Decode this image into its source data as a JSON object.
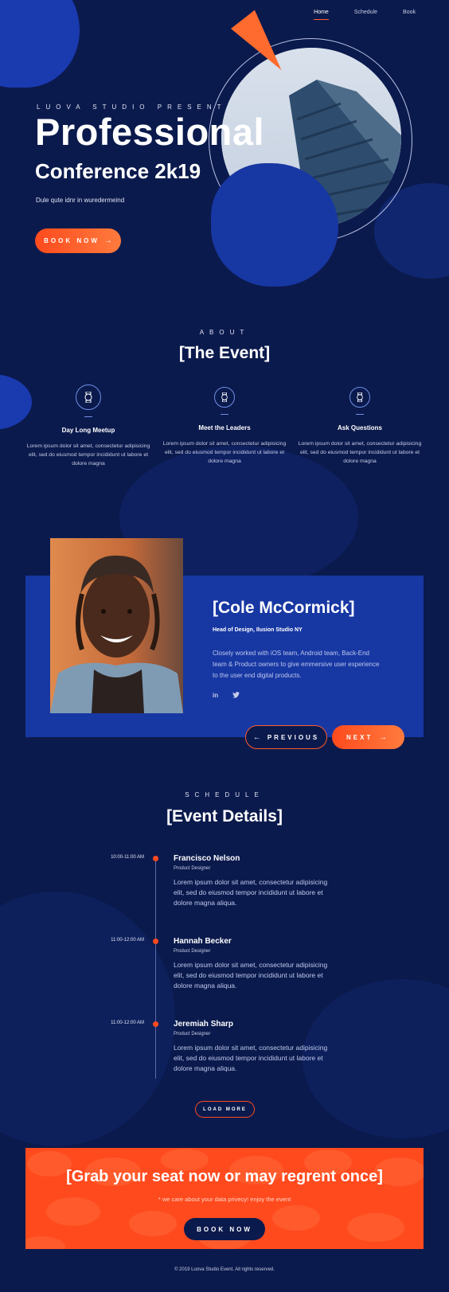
{
  "nav": {
    "items": [
      {
        "label": "Home",
        "active": true
      },
      {
        "label": "Schedule"
      },
      {
        "label": "Book"
      }
    ]
  },
  "hero": {
    "kicker": "LUOVA STUDIO PRESENT",
    "title": "Professional",
    "subtitle": "Conference 2k19",
    "description": "Dule qute idnr in wuredermeind",
    "cta_label": "BOOK NOW"
  },
  "about": {
    "kicker": "ABOUT",
    "title": "[The Event]",
    "features": [
      {
        "icon": "watch-icon",
        "title": "Day Long Meetup",
        "text": "Lorem ipsum dolor sit amet, consectetur adipisicing elit, sed do eiusmod tempor incididunt ut labore et dolore magna"
      },
      {
        "icon": "watch-icon",
        "title": "Meet the Leaders",
        "text": "Lorem ipsum dolor sit amet, consectetur adipisicing elit, sed do eiusmod tempor incididunt ut labore et dolore magna"
      },
      {
        "icon": "watch-icon",
        "title": "Ask Questions",
        "text": "Lorem ipsum dolor sit amet, consectetur adipisicing elit, sed do eiusmod tempor incididunt ut labore et dolore magna"
      }
    ]
  },
  "speaker": {
    "name": "[Cole McCormick]",
    "role": "Head of Design, Ilusion Studio NY",
    "bio": "Closely worked with iOS team, Android team, Back-End team & Product owners to give emmersive user experience to the user end digital products.",
    "social": [
      "linkedin-icon",
      "twitter-icon"
    ],
    "prev_label": "PREVIOUS",
    "next_label": "NEXT"
  },
  "schedule": {
    "kicker": "SCHEDULE",
    "title": "[Event Details]",
    "items": [
      {
        "time": "10:00-11:00 AM",
        "name": "Francisco Nelson",
        "role": "Product Designer",
        "text": "Lorem ipsum dolor sit amet, consectetur adipisicing elit, sed do eiusmod tempor incididunt ut labore et dolore magna aliqua."
      },
      {
        "time": "11:00-12:00 AM",
        "name": "Hannah Becker",
        "role": "Product Designer",
        "text": "Lorem ipsum dolor sit amet, consectetur adipisicing elit, sed do eiusmod tempor incididunt ut labore et dolore magna aliqua."
      },
      {
        "time": "11:00-12:00 AM",
        "name": "Jeremiah Sharp",
        "role": "Product Designer",
        "text": "Lorem ipsum dolor sit amet, consectetur adipisicing elit, sed do eiusmod tempor incididunt ut labore et dolore magna aliqua."
      }
    ],
    "load_more_label": "LOAD MORE"
  },
  "cta": {
    "title": "[Grab your seat now or may regrent once]",
    "note": "* we care about your data privecy! enjoy the event",
    "button_label": "BOOK NOW"
  },
  "footer": {
    "text": "© 2019 Luova Studio Event. All rights reserved."
  },
  "colors": {
    "background": "#0b1a4d",
    "panel": "#1737a3",
    "accent": "#ff4a1e"
  }
}
